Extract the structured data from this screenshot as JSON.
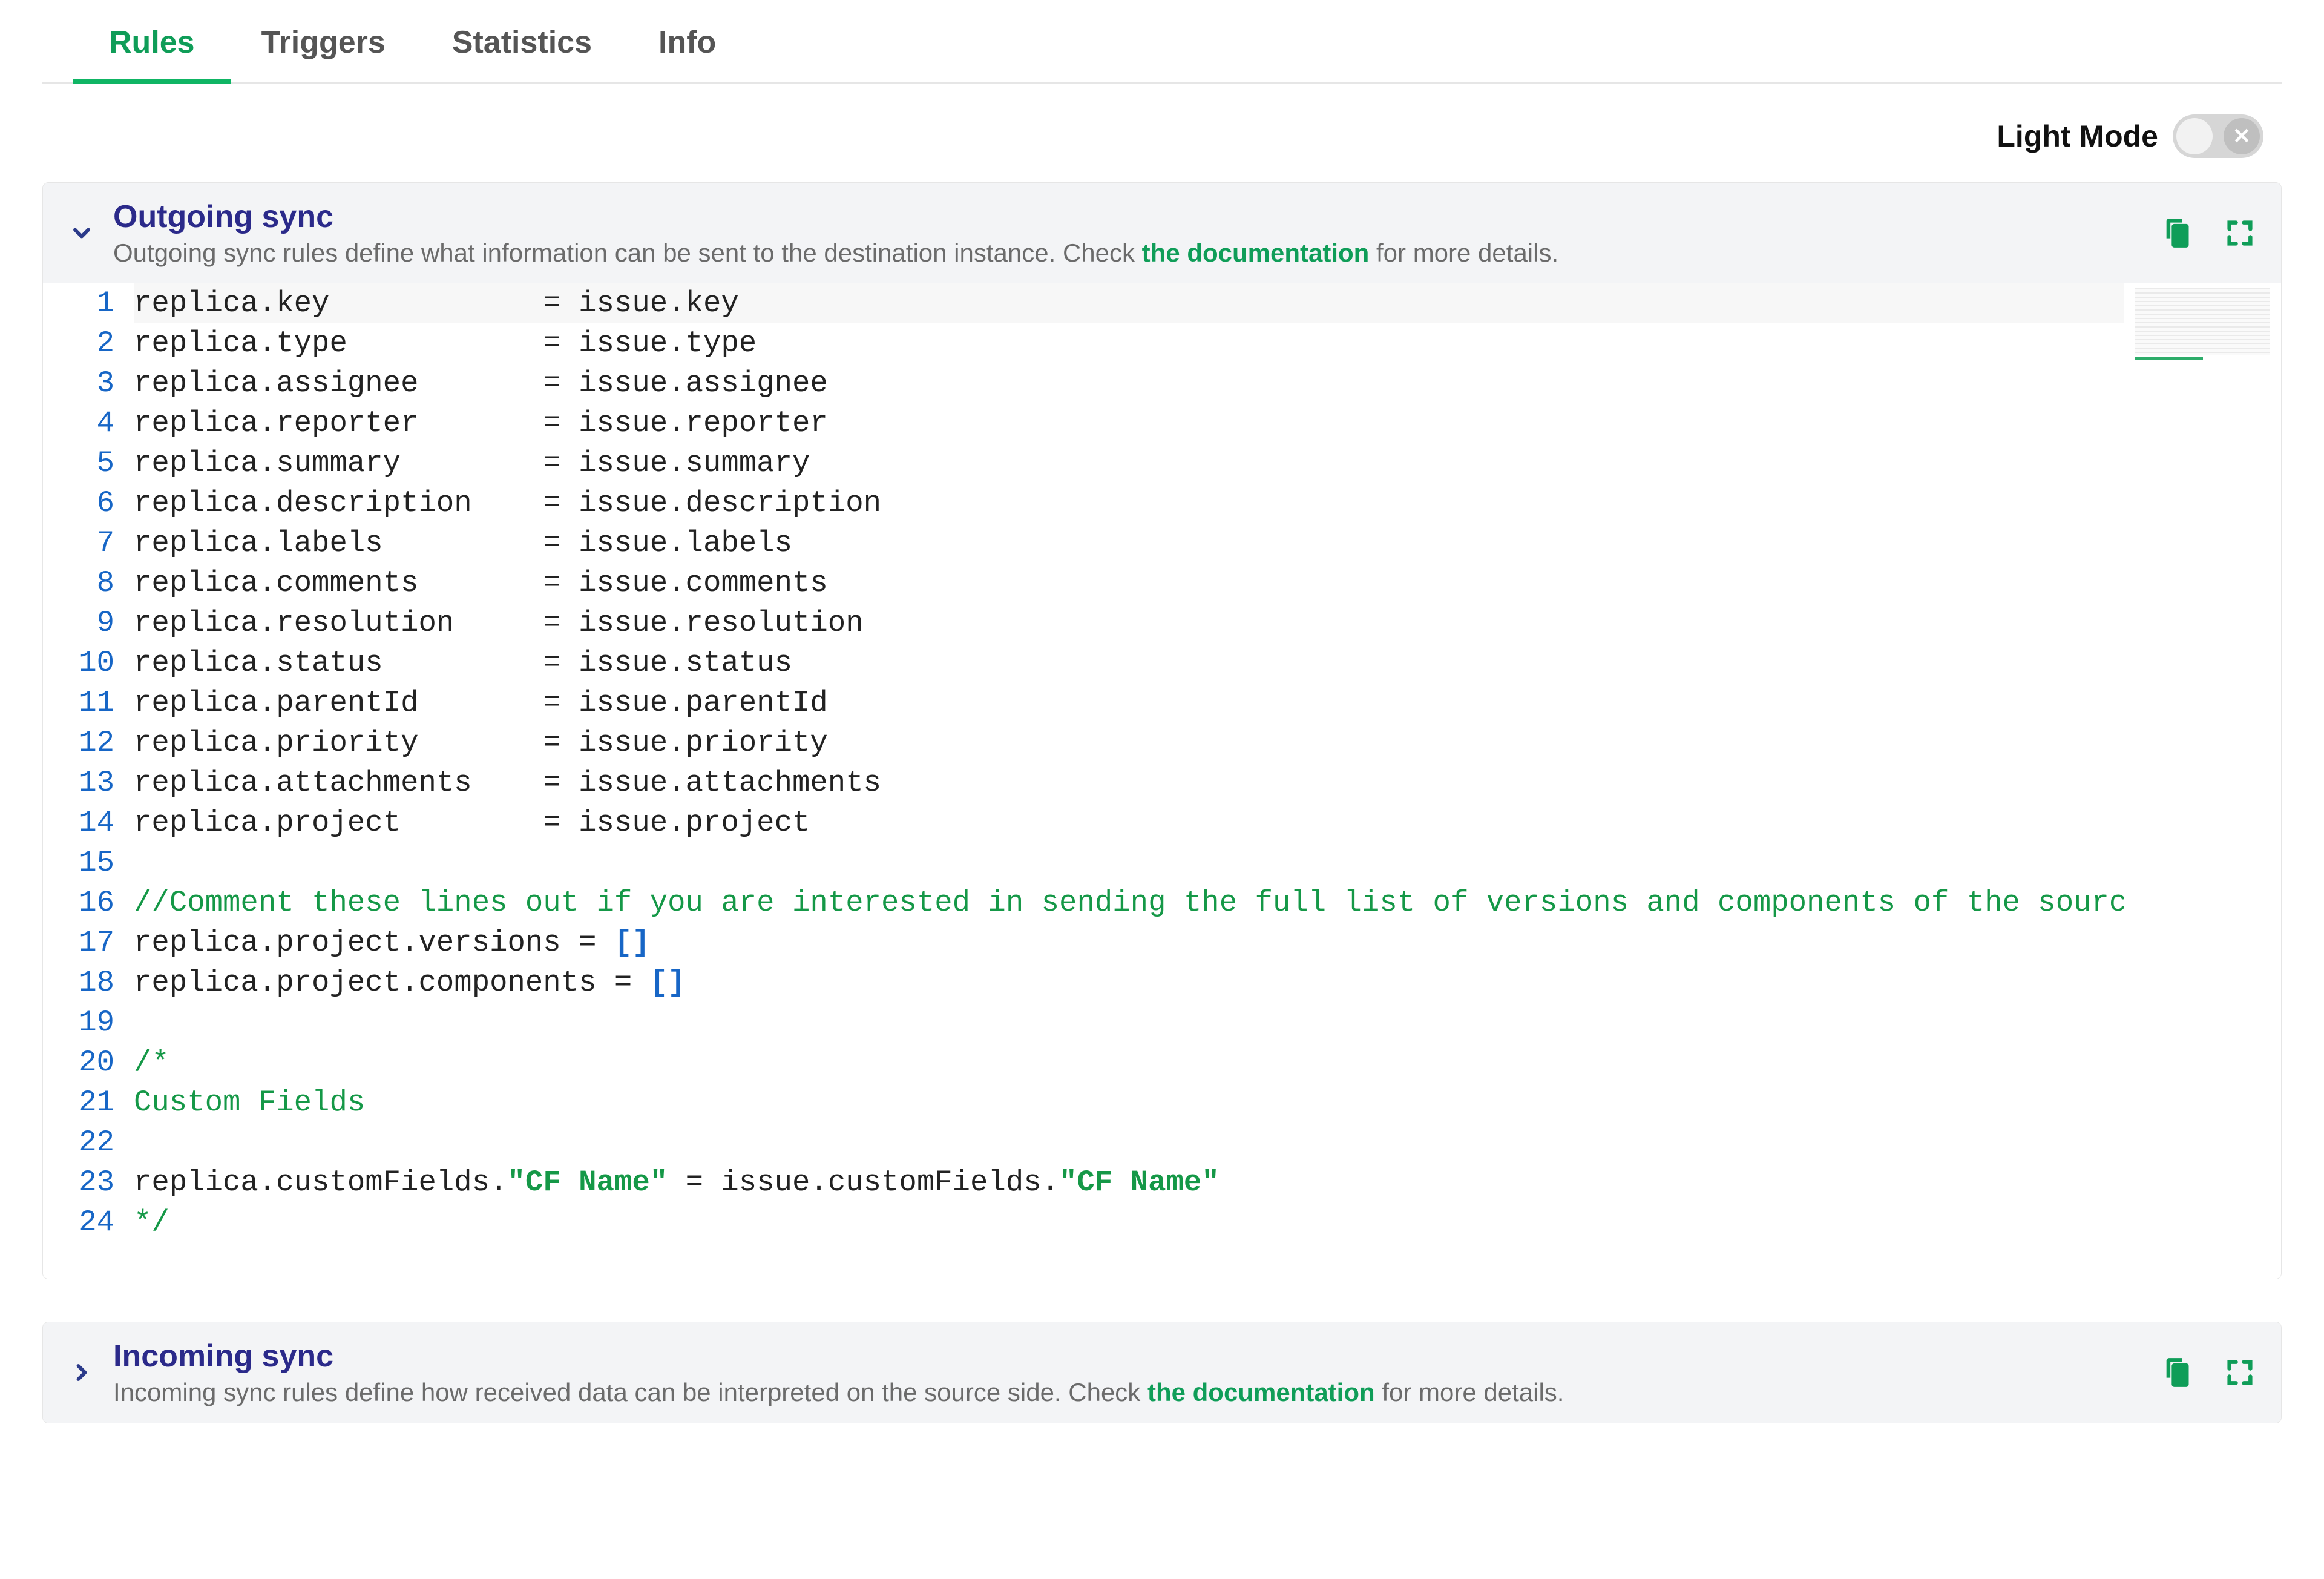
{
  "tabs": [
    {
      "label": "Rules",
      "active": true
    },
    {
      "label": "Triggers",
      "active": false
    },
    {
      "label": "Statistics",
      "active": false
    },
    {
      "label": "Info",
      "active": false
    }
  ],
  "mode": {
    "label": "Light Mode",
    "enabled": false
  },
  "panels": {
    "outgoing": {
      "title": "Outgoing sync",
      "desc_pre": "Outgoing sync rules define what information can be sent to the destination instance. Check ",
      "doc_link": "the documentation",
      "desc_post": " for more details.",
      "expanded": true,
      "code_lines": [
        {
          "n": 1,
          "type": "assign",
          "lhs": "replica.key",
          "rhs": "issue.key",
          "hl": true
        },
        {
          "n": 2,
          "type": "assign",
          "lhs": "replica.type",
          "rhs": "issue.type"
        },
        {
          "n": 3,
          "type": "assign",
          "lhs": "replica.assignee",
          "rhs": "issue.assignee"
        },
        {
          "n": 4,
          "type": "assign",
          "lhs": "replica.reporter",
          "rhs": "issue.reporter"
        },
        {
          "n": 5,
          "type": "assign",
          "lhs": "replica.summary",
          "rhs": "issue.summary"
        },
        {
          "n": 6,
          "type": "assign",
          "lhs": "replica.description",
          "rhs": "issue.description"
        },
        {
          "n": 7,
          "type": "assign",
          "lhs": "replica.labels",
          "rhs": "issue.labels"
        },
        {
          "n": 8,
          "type": "assign",
          "lhs": "replica.comments",
          "rhs": "issue.comments"
        },
        {
          "n": 9,
          "type": "assign",
          "lhs": "replica.resolution",
          "rhs": "issue.resolution"
        },
        {
          "n": 10,
          "type": "assign",
          "lhs": "replica.status",
          "rhs": "issue.status"
        },
        {
          "n": 11,
          "type": "assign",
          "lhs": "replica.parentId",
          "rhs": "issue.parentId"
        },
        {
          "n": 12,
          "type": "assign",
          "lhs": "replica.priority",
          "rhs": "issue.priority"
        },
        {
          "n": 13,
          "type": "assign",
          "lhs": "replica.attachments",
          "rhs": "issue.attachments"
        },
        {
          "n": 14,
          "type": "assign",
          "lhs": "replica.project",
          "rhs": "issue.project"
        },
        {
          "n": 15,
          "type": "blank"
        },
        {
          "n": 16,
          "type": "comment",
          "text": "//Comment these lines out if you are interested in sending the full list of versions and components of the source proje"
        },
        {
          "n": 17,
          "type": "assign-array",
          "lhs": "replica.project.versions",
          "rhs": "[]"
        },
        {
          "n": 18,
          "type": "assign-array",
          "lhs": "replica.project.components",
          "rhs": "[]"
        },
        {
          "n": 19,
          "type": "blank"
        },
        {
          "n": 20,
          "type": "comment",
          "text": "/*"
        },
        {
          "n": 21,
          "type": "comment",
          "text": "Custom Fields"
        },
        {
          "n": 22,
          "type": "blank"
        },
        {
          "n": 23,
          "type": "cf",
          "lhs_a": "replica.customFields.",
          "cf": "\"CF Name\"",
          "mid": " = issue.customFields.",
          "cf2": "\"CF Name\""
        },
        {
          "n": 24,
          "type": "comment",
          "text": "*/"
        }
      ]
    },
    "incoming": {
      "title": "Incoming sync",
      "desc_pre": "Incoming sync rules define how received data can be interpreted on the source side. Check ",
      "doc_link": "the documentation",
      "desc_post": " for more details.",
      "expanded": false
    }
  },
  "colors": {
    "accent": "#0f9d58",
    "title": "#2b2a8a"
  }
}
